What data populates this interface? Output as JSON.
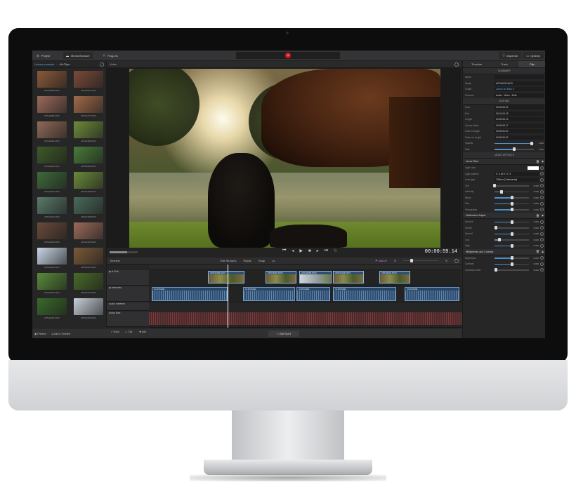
{
  "app": {
    "top_tabs": [
      "Project",
      "Media Browser",
      "Plug-Ins"
    ],
    "right_tabs": [
      "Inspector",
      "Options"
    ]
  },
  "media": {
    "path": [
      "Library example",
      "All Clips"
    ],
    "clips": [
      "APS44980.MOV",
      "APS44987.MOV",
      "APS44956.MOV",
      "APS44477.MOV",
      "APS44481.MOV",
      "APS44482.MOV",
      "APS44981.MOV",
      "APS44983.MOV",
      "APS44413.MOV",
      "APS44426.MOV",
      "APS44423.MOV",
      "APS44425.MOV",
      "APS44430.MOV",
      "APS44426.MOV",
      "APS44000.MOV",
      "APS44967.MOV",
      "APS44200.MOV",
      "APS44201.MOV",
      "APS44202.MOV",
      "APS44203.MOV"
    ],
    "thumb_colors": [
      "#8a5a3a",
      "#7a4a3a",
      "#9a6a5a",
      "#a06a4a",
      "#8f6a58",
      "#6d8a3a",
      "#3e5a2a",
      "#4a7a3a",
      "#3e6a3a",
      "#6a8a3a",
      "#5a7a6a",
      "#4a6a5a",
      "#6a4a3a",
      "#9a6a5a",
      "#c9d7e6",
      "#7a5a3a",
      "#5a8a3a",
      "#4a6a2a",
      "#3a6a2a",
      "#c9d0da"
    ],
    "footer": [
      "Preview",
      "Add to Timeline"
    ]
  },
  "viewer": {
    "title": "Video",
    "timecode": "00:00:59.14"
  },
  "timeline": {
    "title": "Timeline",
    "tools": [
      "Edit Streams",
      "Ripple",
      "Snap"
    ],
    "tracks": [
      "A-Roll",
      "Interview",
      "Audio Intertext",
      "Music Bed"
    ],
    "video_clips": [
      "APS44984.MOV",
      "APS44987.MOV",
      "APS44985.MOV",
      "APS44426.MOV",
      "APS44001.MOV"
    ],
    "audio_clips": [
      "CLIPNAME",
      "CLIPNAME",
      "CLIPNAME",
      "CLIPNAME",
      "CLIPNAME"
    ],
    "marker": "Marker",
    "footer": [
      "Track",
      "Clip",
      "Add",
      "Edit Tool"
    ]
  },
  "inspector": {
    "tabs": [
      "Timeline",
      "Track",
      "Clip"
    ],
    "summary_title": "SUMMARY",
    "summary": [
      {
        "label": "Name",
        "value": ""
      },
      {
        "label": "Media",
        "value": "APS44225.MOV"
      },
      {
        "label": "Folder",
        "value": "Canon 5D Mark II"
      },
      {
        "label": "Streams",
        "value": "Audio · Video · Both"
      }
    ],
    "editing_title": "EDITING",
    "editing": [
      {
        "label": "Start",
        "value": "00:00:55.02"
      },
      {
        "label": "End",
        "value": "00:01:03.15"
      },
      {
        "label": "Length",
        "value": "00:00:08.13"
      },
      {
        "label": "Source offset",
        "value": "00:00:09.17"
      },
      {
        "label": "Fade in length",
        "value": "00:00:00.00"
      },
      {
        "label": "Fade out length",
        "value": "00:00:00.00"
      }
    ],
    "opacity": {
      "label": "Opacity",
      "level": 0.94,
      "value": "1.000"
    },
    "rate": {
      "label": "Rate",
      "level": 0.5,
      "value": "1.000"
    },
    "effects_title": "VIDEO EFFECTS",
    "effects": [
      {
        "name": "Lens Flare",
        "params": [
          {
            "label": "Light color",
            "type": "swatch"
          },
          {
            "label": "Light position",
            "type": "text",
            "value": "X: 0.35  Y: 0.71"
          },
          {
            "label": "Lens type",
            "type": "text",
            "value": "105mm (3 elements)"
          },
          {
            "label": "Tint",
            "type": "slider",
            "level": 0.0,
            "value": "0.000"
          },
          {
            "label": "Intensity",
            "type": "slider",
            "level": 0.2,
            "value": "0.000"
          },
          {
            "label": "Blend",
            "type": "slider",
            "level": 0.5,
            "value": "0.000"
          },
          {
            "label": "Size",
            "type": "slider",
            "level": 0.5,
            "value": "0.000"
          },
          {
            "label": "Perspective",
            "type": "slider",
            "level": 0.5,
            "value": "0.000"
          }
        ]
      },
      {
        "name": "Saturation Adjust",
        "params": [
          {
            "label": "Amount",
            "type": "slider",
            "level": 0.5,
            "value": "0.000"
          },
          {
            "label": "Center",
            "type": "slider",
            "level": 0.05,
            "value": "0.000"
          },
          {
            "label": "Spread",
            "type": "slider",
            "level": 0.5,
            "value": "0.000"
          },
          {
            "label": "Low",
            "type": "slider",
            "level": 0.15,
            "value": "0.000"
          },
          {
            "label": "High",
            "type": "slider",
            "level": 0.5,
            "value": "0.000"
          }
        ]
      },
      {
        "name": "Brightness and Contrast",
        "params": [
          {
            "label": "Brightness",
            "type": "slider",
            "level": 0.5,
            "value": "0.000"
          },
          {
            "label": "Contrast",
            "type": "slider",
            "level": 0.5,
            "value": "0.000"
          },
          {
            "label": "Contrast center",
            "type": "slider",
            "level": 0.05,
            "value": "0.000"
          }
        ]
      }
    ]
  }
}
